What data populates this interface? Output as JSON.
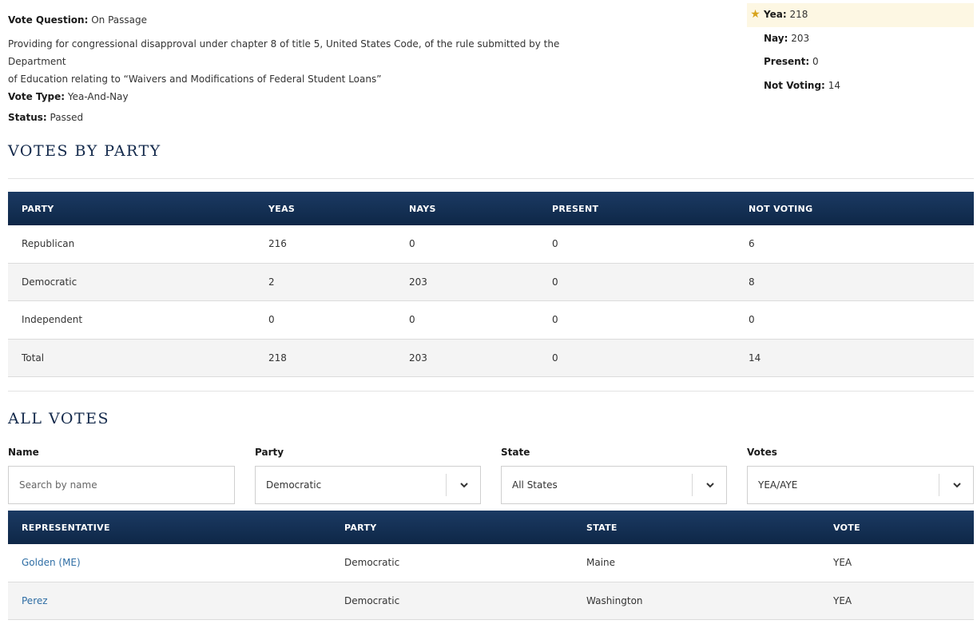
{
  "vote_info": {
    "question_label": "Vote Question:",
    "question_value": "On Passage",
    "description_line1": "Providing for congressional disapproval under chapter 8 of title 5, United States Code, of the rule submitted by the Department",
    "description_line2": "of Education relating to “Waivers and Modifications of Federal Student Loans”",
    "type_label": "Vote Type:",
    "type_value": "Yea-And-Nay",
    "status_label": "Status:",
    "status_value": "Passed"
  },
  "tally": {
    "yea_label": "Yea:",
    "yea_value": "218",
    "nay_label": "Nay:",
    "nay_value": "203",
    "present_label": "Present:",
    "present_value": "0",
    "not_voting_label": "Not Voting:",
    "not_voting_value": "14",
    "winner_icon": "star-icon"
  },
  "votes_by_party": {
    "title": "VOTES BY PARTY",
    "headers": [
      "PARTY",
      "YEAS",
      "NAYS",
      "PRESENT",
      "NOT VOTING"
    ],
    "rows": [
      [
        "Republican",
        "216",
        "0",
        "0",
        "6"
      ],
      [
        "Democratic",
        "2",
        "203",
        "0",
        "8"
      ],
      [
        "Independent",
        "0",
        "0",
        "0",
        "0"
      ],
      [
        "Total",
        "218",
        "203",
        "0",
        "14"
      ]
    ]
  },
  "all_votes": {
    "title": "ALL VOTES",
    "filters": {
      "name_label": "Name",
      "name_placeholder": "Search by name",
      "party_label": "Party",
      "party_value": "Democratic",
      "state_label": "State",
      "state_value": "All States",
      "votes_label": "Votes",
      "votes_value": "YEA/AYE"
    },
    "headers": [
      "REPRESENTATIVE",
      "PARTY",
      "STATE",
      "VOTE"
    ],
    "rows": [
      [
        "Golden (ME)",
        "Democratic",
        "Maine",
        "YEA"
      ],
      [
        "Perez",
        "Democratic",
        "Washington",
        "YEA"
      ]
    ]
  },
  "colors": {
    "header_navy": "#112e51",
    "link_blue": "#2e6da4",
    "winner_highlight": "#fdf7e3",
    "star_gold": "#d8a31a"
  }
}
